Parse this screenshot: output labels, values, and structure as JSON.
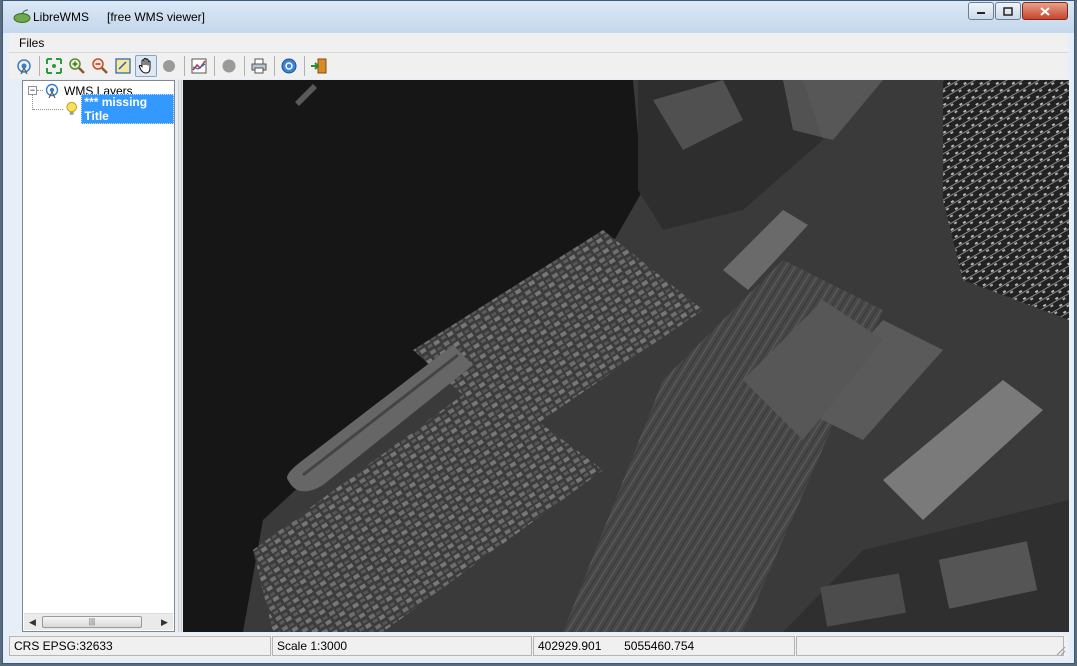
{
  "window": {
    "app_title": "LibreWMS",
    "subtitle": "[free WMS viewer]",
    "controls": [
      "minimize-icon",
      "maximize-icon",
      "close-icon"
    ]
  },
  "menu": {
    "items": [
      {
        "label": "Files"
      }
    ]
  },
  "toolbar": {
    "buttons": [
      {
        "icon": "connect-wms-icon"
      },
      {
        "icon": "zoom-full-extent-icon"
      },
      {
        "icon": "zoom-in-icon"
      },
      {
        "icon": "zoom-out-icon"
      },
      {
        "icon": "zoom-window-icon"
      },
      {
        "icon": "pan-hand-icon",
        "active": true
      },
      {
        "icon": "stop-icon"
      },
      {
        "icon": "layer-properties-icon"
      },
      {
        "icon": "record-icon"
      },
      {
        "icon": "print-icon"
      },
      {
        "icon": "info-icon"
      },
      {
        "icon": "exit-icon"
      }
    ]
  },
  "tree": {
    "root_label": "WMS Layers",
    "root_expander": "−",
    "child_label": "*** missing Title",
    "scrollbar_grip": "|||"
  },
  "status": {
    "crs": "CRS EPSG:32633",
    "scale": "Scale 1:3000",
    "x": "402929.901",
    "y": "5055460.754"
  },
  "colors": {
    "titlebar": "#c4d7ec",
    "selection": "#3399ff",
    "map_water": "#161616",
    "close_button": "#c8452c"
  }
}
